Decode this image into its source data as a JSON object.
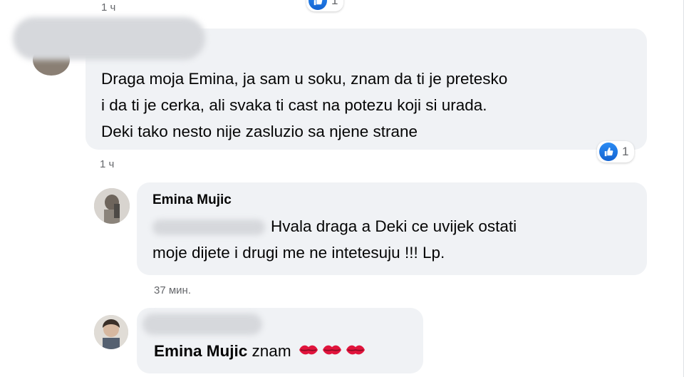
{
  "top": {
    "time": "1 ч",
    "reaction_count": "1"
  },
  "comment1": {
    "text_lines": [
      "Draga moja Emina, ja sam u soku, znam da ti je pretesko",
      "i da ti je cerka, ali svaka ti cast na potezu koji si urada.",
      "Deki tako nesto nije zasluzio sa njene strane"
    ],
    "time": "1 ч",
    "reaction_count": "1"
  },
  "reply1": {
    "author": "Emina Mujic",
    "text_line1": "Hvala draga a Deki ce uvijek ostati",
    "text_line2": "moje dijete i drugi me ne intetesuju !!! Lp.",
    "time": "37 мин."
  },
  "reply2": {
    "author": "Emina Mujic",
    "text": "znam"
  },
  "colors": {
    "bubble": "#f0f2f5",
    "meta": "#65676b",
    "like_blue": "#1877f2"
  }
}
